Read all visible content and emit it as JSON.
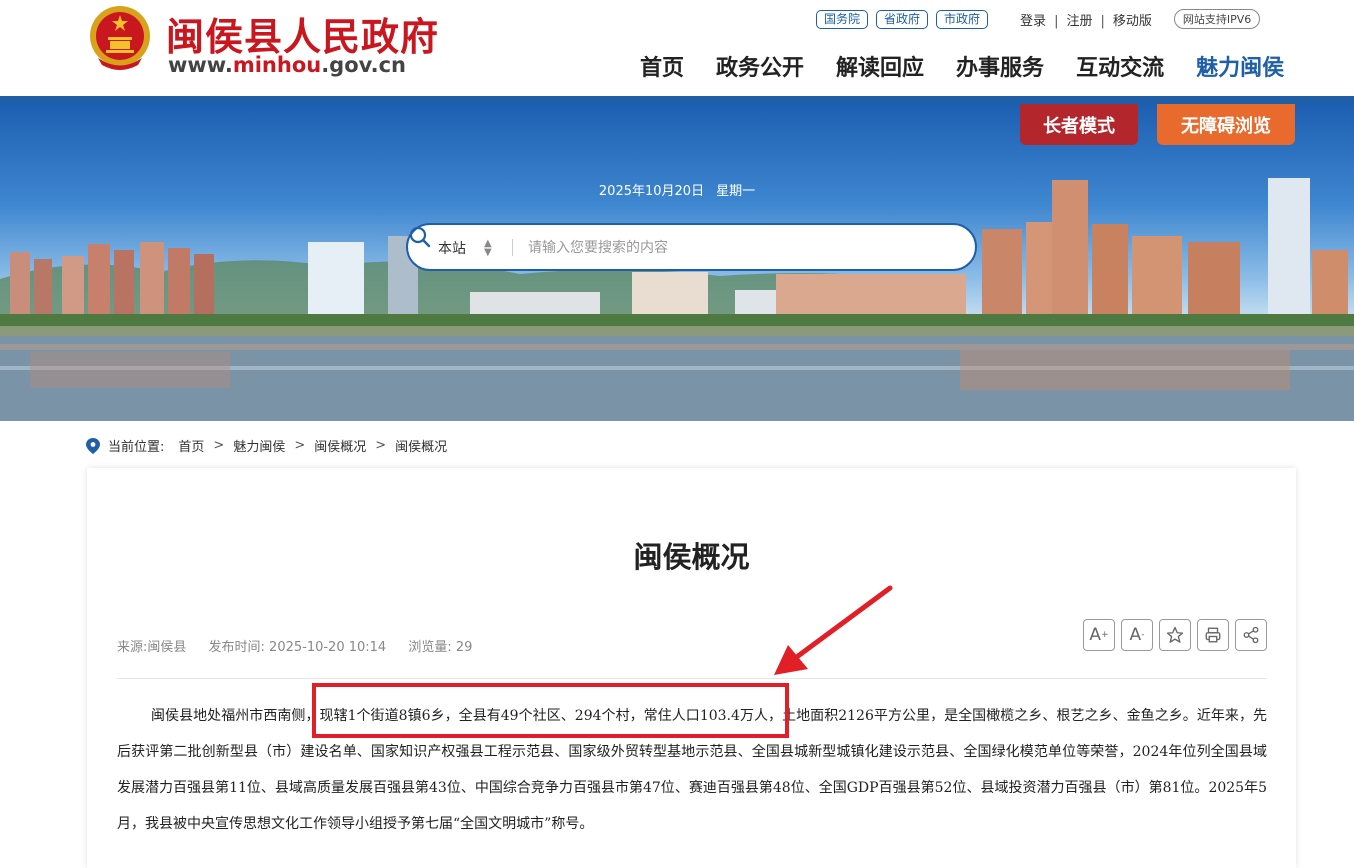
{
  "header": {
    "site_name": "闽侯县人民政府",
    "url_prefix": "www.",
    "url_highlight": "minhou",
    "url_suffix": ".gov.cn",
    "gov_links": [
      "国务院",
      "省政府",
      "市政府"
    ],
    "account": {
      "login": "登录",
      "register": "注册",
      "mobile": "移动版",
      "sep": "|"
    },
    "ipv6": "网站支持IPV6",
    "nav": [
      "首页",
      "政务公开",
      "解读回应",
      "办事服务",
      "互动交流",
      "魅力闽侯"
    ],
    "nav_active": "魅力闽侯"
  },
  "banner": {
    "elder_mode": "长者模式",
    "accessible": "无障碍浏览",
    "date": "2025年10月20日",
    "weekday": "星期一",
    "search_scope": "本站",
    "search_placeholder": "请输入您要搜索的内容"
  },
  "breadcrumb": {
    "label": "当前位置:",
    "items": [
      "首页",
      "魅力闽侯",
      "闽侯概况",
      "闽侯概况"
    ],
    "sep": ">"
  },
  "article": {
    "title": "闽侯概况",
    "source": "来源:闽侯县",
    "publish_time": "发布时间: 2025-10-20 10:14",
    "views": "浏览量: 29",
    "tools": {
      "font_up": "A",
      "font_down": "A",
      "font_up_sup": "+",
      "font_down_sup": "-"
    },
    "body": "闽侯县地处福州市西南侧，现辖1个街道8镇6乡，全县有49个社区、294个村，常住人口103.4万人，土地面积2126平方公里，是全国橄榄之乡、根艺之乡、金鱼之乡。近年来，先后获评第二批创新型县（市）建设名单、国家知识产权强县工程示范县、国家级外贸转型基地示范县、全国县城新型城镇化建设示范县、全国绿化模范单位等荣誉，2024年位列全国县域发展潜力百强县第11位、县域高质量发展百强县第43位、中国综合竞争力百强县市第47位、赛迪百强县第48位、全国GDP百强县第52位、县域投资潜力百强县（市）第81位。2025年5月，我县被中央宣传思想文化工作领导小组授予第七届“全国文明城市”称号。"
  },
  "colors": {
    "brand_blue": "#1e5fa8",
    "brand_red": "#c8171e",
    "elder_btn": "#b3262c",
    "access_btn": "#e86a2c",
    "annotation": "#e01f26"
  }
}
